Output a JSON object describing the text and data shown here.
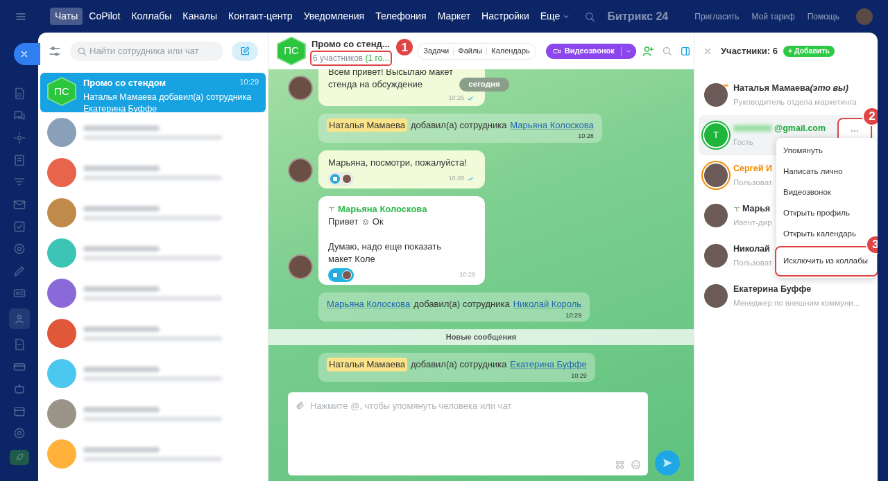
{
  "top_nav": {
    "items": [
      {
        "label": "Чаты",
        "selected": true
      },
      {
        "label": "CoPilot",
        "selected": false
      },
      {
        "label": "Коллабы",
        "selected": false
      },
      {
        "label": "Каналы",
        "selected": false
      },
      {
        "label": "Контакт-центр",
        "selected": false
      },
      {
        "label": "Уведомления",
        "selected": false
      },
      {
        "label": "Телефония",
        "selected": false
      },
      {
        "label": "Маркет",
        "selected": false
      },
      {
        "label": "Настройки",
        "selected": false
      }
    ],
    "more": "Еще",
    "brand": "Битрикс 24",
    "links": [
      "Пригласить",
      "Мой тариф",
      "Помощь"
    ]
  },
  "chat_list": {
    "search_placeholder": "Найти сотрудника или чат",
    "active_chat": {
      "avatar": "ПС",
      "title": "Промо со стендом",
      "time": "10:29",
      "preview": "Наталья Мамаева добавил(а) сотрудника Екатерина Буффе",
      "selected": true
    },
    "blurred_chats": [
      {
        "color": "#8aa0b8"
      },
      {
        "color": "#e8644a"
      },
      {
        "color": "#c08a4a"
      },
      {
        "color": "#3cc4b4"
      },
      {
        "color": "#8a6ad8"
      },
      {
        "color": "#e0573a"
      },
      {
        "color": "#4cc8f0"
      },
      {
        "color": "#9a9488"
      },
      {
        "color": "#ffb13c"
      }
    ]
  },
  "chat": {
    "avatar": "ПС",
    "title": "Промо со стенд...",
    "members_text": "6 участников",
    "guests_text": "(1 го...",
    "annotation": "1",
    "tabs": [
      "Задачи",
      "Файлы",
      "Календарь"
    ],
    "video_button": "Видеозвонок",
    "date_pill": "сегодня",
    "new_messages": "Новые сообщения",
    "messages": [
      {
        "kind": "message",
        "own": true,
        "text": "Всем привет! Высылаю макет стенда на обсуждение",
        "time": "10:26",
        "read": true
      },
      {
        "kind": "system",
        "parts": [
          {
            "kind": "mention",
            "text": "Наталья Мамаева"
          },
          {
            "kind": "text",
            "text": "добавил(а) сотрудника"
          },
          {
            "kind": "link",
            "text": "Марьяна Колоскова"
          }
        ],
        "time": "10:28"
      },
      {
        "kind": "message",
        "own": true,
        "text": "Марьяна, посмотри, пожалуйста!",
        "time": "10:28",
        "read": true,
        "reacted": true,
        "reaction_mine": false
      },
      {
        "kind": "message",
        "own": false,
        "author": "Марьяна Колоскова",
        "text": "Привет ☺ Ок\n\nДумаю, надо еще показать макет Коле",
        "time": "10:29",
        "reacted": true,
        "reaction_mine": true
      },
      {
        "kind": "system",
        "parts": [
          {
            "kind": "link",
            "text": "Марьяна Колоскова"
          },
          {
            "kind": "text",
            "text": "добавил(а) сотрудника"
          },
          {
            "kind": "link",
            "text": "Николай Король"
          }
        ],
        "time": "10:29"
      },
      {
        "kind": "divider"
      },
      {
        "kind": "system",
        "parts": [
          {
            "kind": "mention",
            "text": "Наталья Мамаева"
          },
          {
            "kind": "text",
            "text": "добавил(а) сотрудника"
          },
          {
            "kind": "link",
            "text": "Екатерина Буффе"
          }
        ],
        "time": "10:29"
      }
    ],
    "composer_placeholder": "Нажмите @, чтобы упомянуть человека или чат"
  },
  "members": {
    "title": "Участники: 6",
    "add_button": "+ Добавить",
    "list": [
      {
        "name": "Наталья Мамаева",
        "suffix": "(это вы)",
        "role": "Руководитель отдела маркетинга",
        "crown": true,
        "color": "#333333",
        "selected": false
      },
      {
        "name": "@gmail.com",
        "role": "Гость",
        "avatar_letter": "T",
        "color": "#1ea838",
        "selected": true,
        "blurred_prefix": true,
        "annotation": "2"
      },
      {
        "name": "Сергей И",
        "role": "Пользоват",
        "ring": true,
        "color": "#f08a00",
        "selected": false
      },
      {
        "name": "Марья",
        "role": "Ивент-дир",
        "palm": true,
        "color": "#333333",
        "selected": false
      },
      {
        "name": "Николай",
        "role": "Пользоват",
        "color": "#333333",
        "selected": false
      },
      {
        "name": "Екатерина Буффе",
        "role": "Менеджер по внешним коммуни...",
        "color": "#333333",
        "selected": false
      }
    ],
    "menu": [
      {
        "label": "Упомянуть"
      },
      {
        "label": "Написать лично"
      },
      {
        "label": "Видеозвонок"
      },
      {
        "label": "Открыть профиль"
      },
      {
        "label": "Открыть календарь"
      },
      {
        "label": "Исключить из коллабы",
        "annotation": "3"
      }
    ]
  }
}
